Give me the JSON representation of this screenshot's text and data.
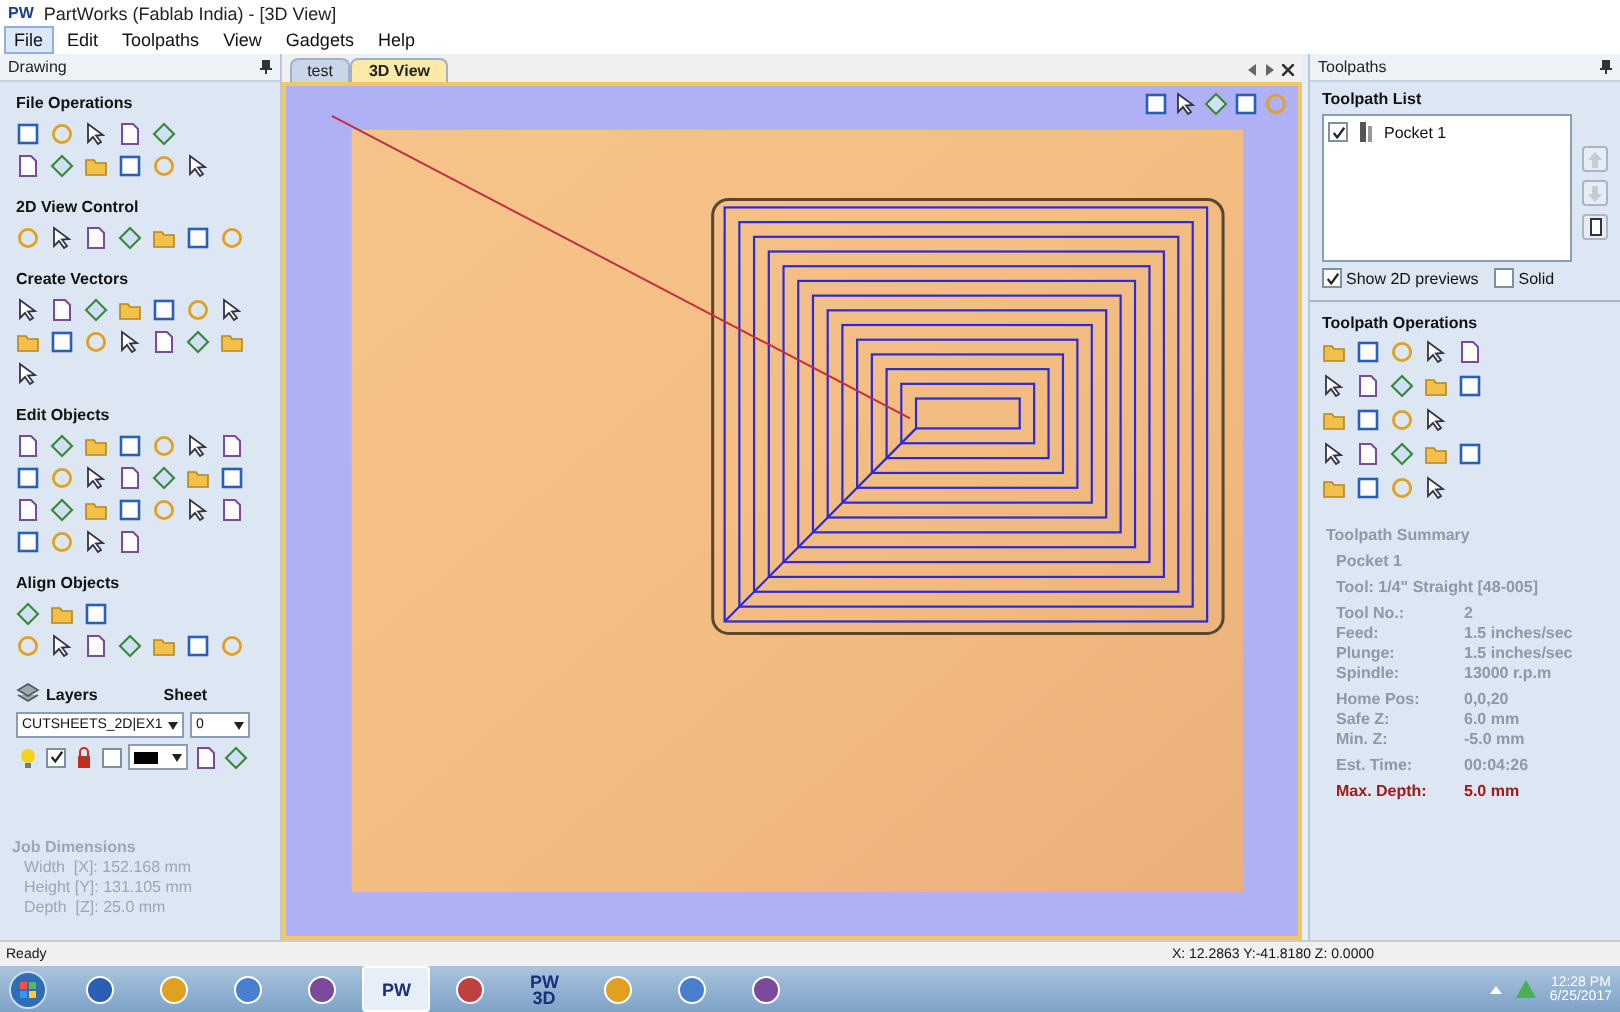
{
  "window": {
    "logo": "PW",
    "title": "PartWorks (Fablab India) - [3D View]"
  },
  "menu": [
    {
      "label": "File",
      "selected": true
    },
    {
      "label": "Edit",
      "selected": false
    },
    {
      "label": "Toolpaths",
      "selected": false
    },
    {
      "label": "View",
      "selected": false
    },
    {
      "label": "Gadgets",
      "selected": false
    },
    {
      "label": "Help",
      "selected": false
    }
  ],
  "drawing_panel": {
    "title": "Drawing",
    "sections": [
      {
        "title": "File Operations"
      },
      {
        "title": "2D View Control"
      },
      {
        "title": "Create Vectors"
      },
      {
        "title": "Edit Objects"
      },
      {
        "title": "Align Objects"
      }
    ],
    "layers": {
      "title": "Layers",
      "sheet_label": "Sheet",
      "layer": "CUTSHEETS_2D|EX1",
      "sheet": "0",
      "visible_checked": true,
      "locked_checked": false
    },
    "job_dimensions": {
      "title": "Job Dimensions",
      "lines": [
        "Width  [X]: 152.168 mm",
        "Height [Y]: 131.105 mm",
        "Depth  [Z]: 25.0 mm"
      ]
    }
  },
  "view": {
    "tabs": [
      {
        "label": "test",
        "selected": false
      },
      {
        "label": "3D View",
        "selected": true
      }
    ]
  },
  "toolpaths_panel": {
    "title": "Toolpaths",
    "list_title": "Toolpath List",
    "items": [
      {
        "name": "Pocket 1",
        "checked": true
      }
    ],
    "options": [
      {
        "label": "Show 2D previews",
        "checked": true
      },
      {
        "label": "Solid",
        "checked": false
      }
    ],
    "operations_title": "Toolpath Operations",
    "summary": {
      "title": "Toolpath Summary",
      "name": "Pocket 1",
      "tool": "Tool: 1/4\" Straight  [48-005]",
      "groups": [
        [
          {
            "label": "Tool No.:",
            "value": "2",
            "kind": "normal"
          },
          {
            "label": "Feed:",
            "value": "1.5 inches/sec",
            "kind": "normal"
          },
          {
            "label": "Plunge:",
            "value": "1.5 inches/sec",
            "kind": "normal"
          },
          {
            "label": "Spindle:",
            "value": "13000 r.p.m",
            "kind": "normal"
          }
        ],
        [
          {
            "label": "Home Pos:",
            "value": "0,0,20",
            "kind": "normal"
          },
          {
            "label": "Safe Z:",
            "value": "6.0 mm",
            "kind": "normal"
          },
          {
            "label": "Min. Z:",
            "value": "-5.0 mm",
            "kind": "normal"
          }
        ],
        [
          {
            "label": "Est. Time:",
            "value": "00:04:26",
            "kind": "normal"
          }
        ],
        [
          {
            "label": "Max. Depth:",
            "value": "5.0 mm",
            "kind": "highlight"
          }
        ]
      ]
    }
  },
  "status_bar": {
    "message": "Ready",
    "coordinates": "X: 12.2863 Y:-41.8180 Z:  0.0000"
  },
  "taskbar": {
    "items": [
      {
        "kind": "icon",
        "selected": false
      },
      {
        "kind": "icon",
        "selected": false
      },
      {
        "kind": "icon",
        "selected": false
      },
      {
        "kind": "icon",
        "selected": false
      },
      {
        "kind": "text",
        "label": "PW",
        "selected": true
      },
      {
        "kind": "icon",
        "selected": false
      },
      {
        "kind": "text",
        "label": "PW 3D",
        "selected": false
      },
      {
        "kind": "icon",
        "selected": false
      },
      {
        "kind": "icon",
        "selected": false
      },
      {
        "kind": "icon",
        "selected": false
      }
    ],
    "time": "12:28 PM",
    "date": "6/25/2017"
  }
}
